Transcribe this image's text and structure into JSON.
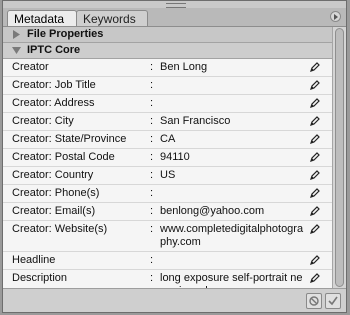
{
  "tabs": [
    {
      "label": "Metadata",
      "active": true
    },
    {
      "label": "Keywords",
      "active": false
    }
  ],
  "sections": {
    "file_properties": {
      "label": "File Properties",
      "expanded": false
    },
    "iptc_core": {
      "label": "IPTC Core",
      "expanded": true
    }
  },
  "fields": [
    {
      "label": "Creator",
      "value": "Ben Long"
    },
    {
      "label": "Creator: Job Title",
      "value": ""
    },
    {
      "label": "Creator: Address",
      "value": ""
    },
    {
      "label": "Creator: City",
      "value": "San Francisco"
    },
    {
      "label": "Creator: State/Province",
      "value": "CA"
    },
    {
      "label": "Creator: Postal Code",
      "value": "94110"
    },
    {
      "label": "Creator: Country",
      "value": "US"
    },
    {
      "label": "Creator: Phone(s)",
      "value": ""
    },
    {
      "label": "Creator: Email(s)",
      "value": "benlong@yahoo.com"
    },
    {
      "label": "Creator: Website(s)",
      "value": "www.completedigitalphotography.com"
    },
    {
      "label": "Headline",
      "value": ""
    },
    {
      "label": "Description",
      "value": "long exposure self-portrait near pinnacles"
    }
  ],
  "footer": {
    "cancel_icon": "no-entry-icon",
    "apply_icon": "checkmark-icon"
  },
  "colors": {
    "panel_bg": "#e6e6e6",
    "section_header": "#c7c7c7",
    "row_bg": "#f5f5f5"
  }
}
